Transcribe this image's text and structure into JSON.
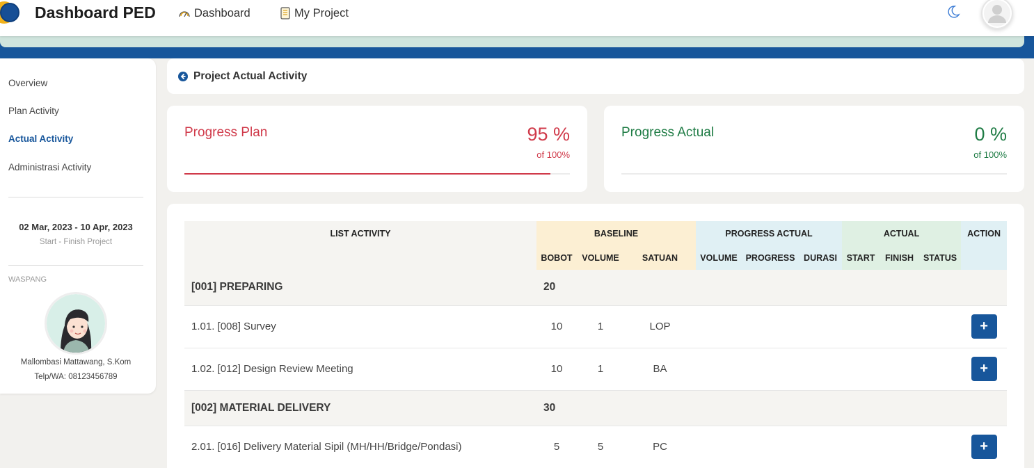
{
  "navbar": {
    "brand": "Dashboard PED",
    "links": [
      {
        "label": "Dashboard",
        "icon": "gauge-icon"
      },
      {
        "label": "My Project",
        "icon": "notebook-icon"
      }
    ],
    "theme_icon": "moon-icon",
    "avatar_icon": "user-avatar-icon"
  },
  "sidebar": {
    "items": [
      {
        "label": "Overview",
        "active": false
      },
      {
        "label": "Plan Activity",
        "active": false
      },
      {
        "label": "Actual Activity",
        "active": true
      },
      {
        "label": "Administrasi Activity",
        "active": false
      }
    ],
    "date_range": "02 Mar, 2023 - 10 Apr, 2023",
    "date_caption": "Start - Finish Project",
    "role_label": "WASPANG",
    "person_name": "Mallombasi Mattawang, S.Kom",
    "person_phone": "Telp/WA: 08123456789"
  },
  "page": {
    "title": "Project Actual Activity"
  },
  "progress_plan": {
    "label": "Progress Plan",
    "value": "95 %",
    "of": "of 100%",
    "percent": 95,
    "color": "#d03a4a"
  },
  "progress_actual": {
    "label": "Progress Actual",
    "value": "0 %",
    "of": "of 100%",
    "percent": 0,
    "color": "#1f7c45"
  },
  "table": {
    "headers": {
      "list": "LIST ACTIVITY",
      "baseline": "BASELINE",
      "progress_actual": "PROGRESS ACTUAL",
      "actual": "ACTUAL",
      "action": "ACTION",
      "bobot": "BOBOT",
      "volume": "VOLUME",
      "satuan": "SATUAN",
      "pa_volume": "VOLUME",
      "pa_progress": "PROGRESS",
      "pa_durasi": "DURASI",
      "start": "START",
      "finish": "FINISH",
      "status": "STATUS"
    },
    "rows": [
      {
        "type": "group",
        "name": "[001] PREPARING",
        "bobot": "20"
      },
      {
        "type": "item",
        "name": "1.01. [008] Survey",
        "bobot": "10",
        "volume": "1",
        "satuan": "LOP",
        "action": "+"
      },
      {
        "type": "item",
        "name": "1.02. [012] Design Review Meeting",
        "bobot": "10",
        "volume": "1",
        "satuan": "BA",
        "action": "+"
      },
      {
        "type": "group",
        "name": "[002] MATERIAL DELIVERY",
        "bobot": "30"
      },
      {
        "type": "item",
        "name": "2.01. [016] Delivery Material Sipil (MH/HH/Bridge/Pondasi)",
        "bobot": "5",
        "volume": "5",
        "satuan": "PC",
        "action": "+"
      }
    ]
  }
}
